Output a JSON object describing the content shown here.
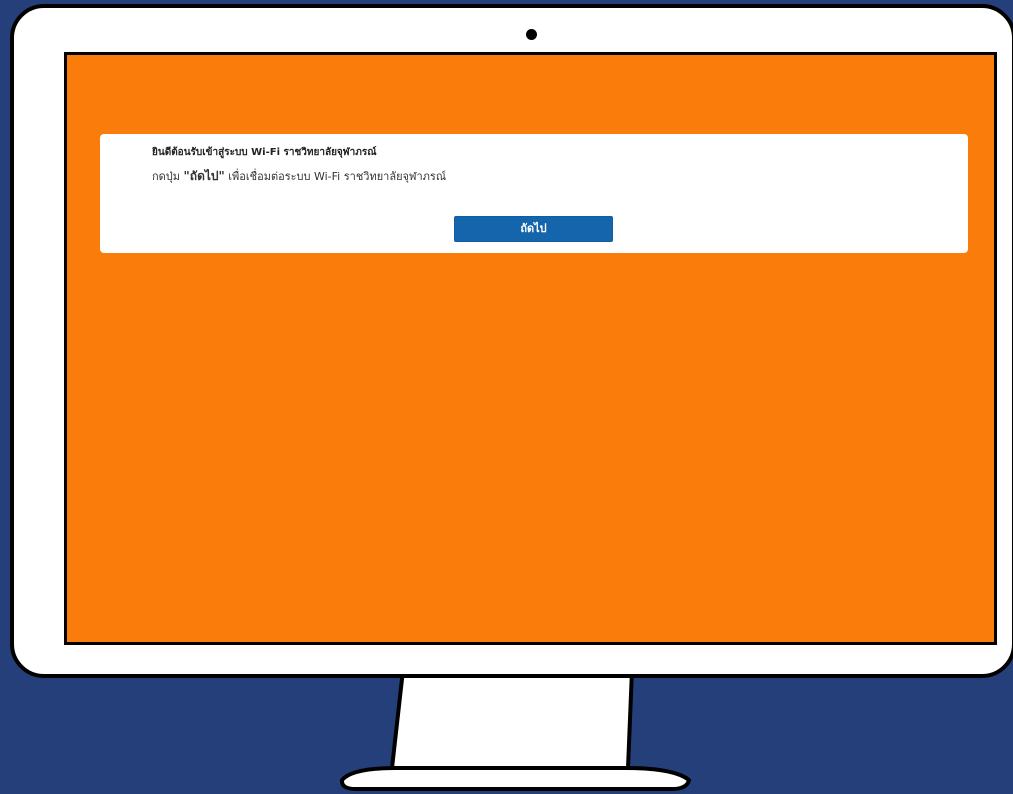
{
  "colors": {
    "page_background": "#253f7b",
    "screen_background": "#fa7d0c",
    "card_background": "#ffffff",
    "button_background": "#1565ad",
    "monitor_frame": "#ffffff",
    "outline": "#000000"
  },
  "illustration": {
    "camera_icon": "webcam-dot",
    "stand_icon": "monitor-stand"
  },
  "welcome": {
    "title": "ยินดีต้อนรับเข้าสู่ระบบ Wi-Fi ราชวิทยาลัยจุฬาภรณ์",
    "instruction_prefix": "กดปุ่ม",
    "instruction_button_ref": "\"ถัดไป\"",
    "instruction_suffix": "เพื่อเชื่อมต่อระบบ Wi-Fi ราชวิทยาลัยจุฬาภรณ์",
    "next_label": "ถัดไป"
  }
}
